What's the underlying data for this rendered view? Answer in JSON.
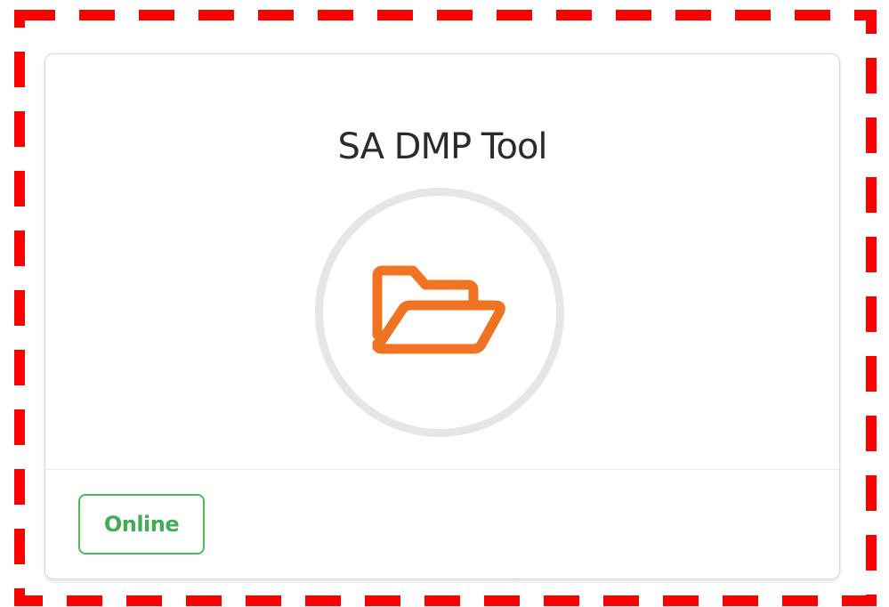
{
  "card": {
    "title": "SA DMP Tool",
    "icon": "folder-open-icon",
    "status": "Online"
  },
  "colors": {
    "highlight_border": "#ff0000",
    "icon_orange": "#f07323",
    "status_green": "#3fae55",
    "ring_gray": "#e6e6e6"
  }
}
